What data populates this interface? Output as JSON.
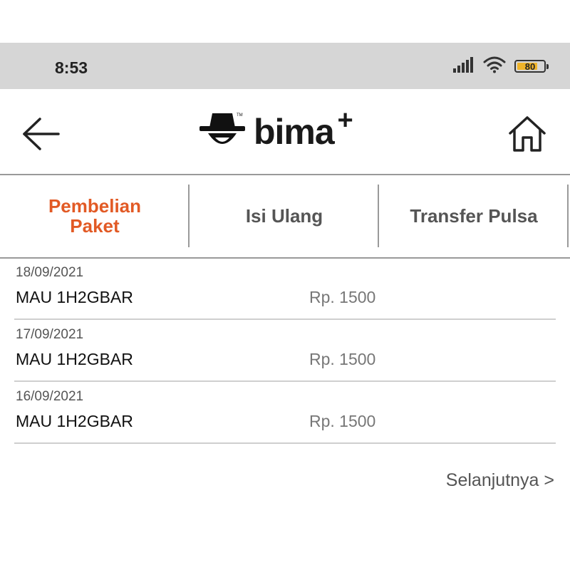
{
  "status_bar": {
    "time": "8:53",
    "battery": "80",
    "battery_level": 0.8
  },
  "header": {
    "brand": "bima",
    "brand_plus": "+",
    "trademark": "TM"
  },
  "tabs": [
    {
      "label_line1": "Pembelian",
      "label_line2": "Paket",
      "active": true
    },
    {
      "label": "Isi Ulang",
      "active": false
    },
    {
      "label": "Transfer Pulsa",
      "active": false
    }
  ],
  "transactions": [
    {
      "date": "18/09/2021",
      "name": "MAU 1H2GBAR",
      "price": "Rp. 1500"
    },
    {
      "date": "17/09/2021",
      "name": "MAU 1H2GBAR",
      "price": "Rp. 1500"
    },
    {
      "date": "16/09/2021",
      "name": "MAU 1H2GBAR",
      "price": "Rp. 1500"
    }
  ],
  "pagination": {
    "next_label": "Selanjutnya >"
  },
  "colors": {
    "accent": "#e25a25",
    "status_bar_bg": "#d6d6d6",
    "battery": "#f0b429"
  }
}
